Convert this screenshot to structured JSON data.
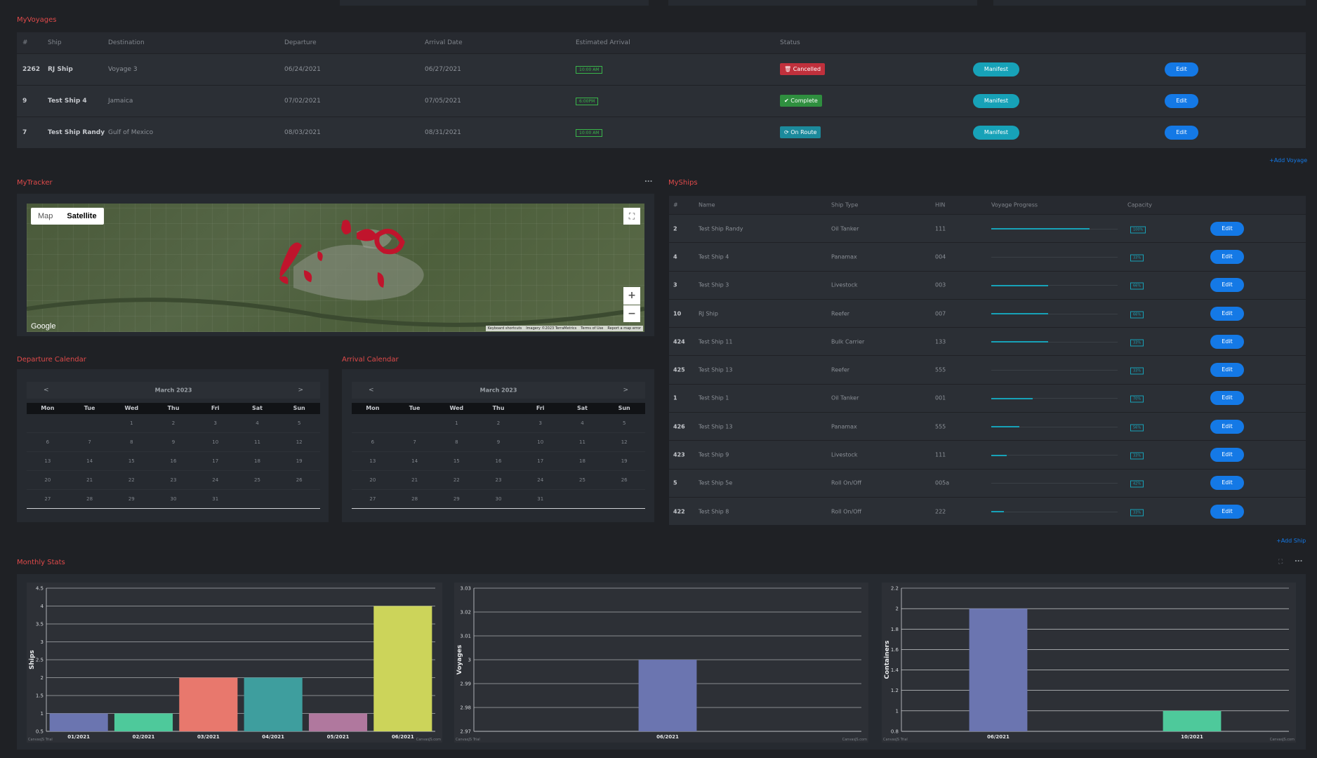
{
  "voyages": {
    "title": "MyVoyages",
    "headers": [
      "#",
      "Ship",
      "Destination",
      "Departure",
      "Arrival Date",
      "Estimated Arrival",
      "Status"
    ],
    "rows": [
      {
        "id": "2262",
        "ship": "RJ Ship",
        "destination": "Voyage 3",
        "departure": "06/24/2021",
        "arrival": "06/27/2021",
        "eta": "10:00 AM",
        "status": "Cancelled",
        "manifest": "Manifest",
        "edit": "Edit"
      },
      {
        "id": "9",
        "ship": "Test Ship 4",
        "destination": "Jamaica",
        "departure": "07/02/2021",
        "arrival": "07/05/2021",
        "eta": "6:00PM",
        "status": "Complete",
        "manifest": "Manifest",
        "edit": "Edit"
      },
      {
        "id": "7",
        "ship": "Test Ship Randy",
        "destination": "Gulf of Mexico",
        "departure": "08/03/2021",
        "arrival": "08/31/2021",
        "eta": "10:00 AM",
        "status": "On Route",
        "manifest": "Manifest",
        "edit": "Edit"
      }
    ],
    "add_link": "+Add Voyage"
  },
  "tracker": {
    "title": "MyTracker",
    "menu": "...",
    "map_label": "Map",
    "satellite_label": "Satellite",
    "google": "Google",
    "footer": [
      "Keyboard shortcuts",
      "Imagery ©2023 TerraMetrics",
      "Terms of Use",
      "Report a map error"
    ]
  },
  "departure_calendar": {
    "title": "Departure Calendar",
    "month": "March 2023",
    "prev": "<",
    "next": ">",
    "weekdays": [
      "Mon",
      "Tue",
      "Wed",
      "Thu",
      "Fri",
      "Sat",
      "Sun"
    ],
    "weeks": [
      [
        "",
        "",
        "1",
        "2",
        "3",
        "4",
        "5"
      ],
      [
        "6",
        "7",
        "8",
        "9",
        "10",
        "11",
        "12"
      ],
      [
        "13",
        "14",
        "15",
        "16",
        "17",
        "18",
        "19"
      ],
      [
        "20",
        "21",
        "22",
        "23",
        "24",
        "25",
        "26"
      ],
      [
        "27",
        "28",
        "29",
        "30",
        "31",
        "",
        ""
      ]
    ]
  },
  "arrival_calendar": {
    "title": "Arrival Calendar",
    "month": "March 2023",
    "prev": "<",
    "next": ">",
    "weekdays": [
      "Mon",
      "Tue",
      "Wed",
      "Thu",
      "Fri",
      "Sat",
      "Sun"
    ],
    "weeks": [
      [
        "",
        "",
        "1",
        "2",
        "3",
        "4",
        "5"
      ],
      [
        "6",
        "7",
        "8",
        "9",
        "10",
        "11",
        "12"
      ],
      [
        "13",
        "14",
        "15",
        "16",
        "17",
        "18",
        "19"
      ],
      [
        "20",
        "21",
        "22",
        "23",
        "24",
        "25",
        "26"
      ],
      [
        "27",
        "28",
        "29",
        "30",
        "31",
        "",
        ""
      ]
    ]
  },
  "ships": {
    "title": "MyShips",
    "headers": [
      "#",
      "Name",
      "Ship Type",
      "HIN",
      "Voyage Progress",
      "Capacity"
    ],
    "rows": [
      {
        "id": "2",
        "name": "Test Ship Randy",
        "type": "Oil Tanker",
        "hin": "111",
        "progress": 0.78,
        "capacity": "100%",
        "edit": "Edit"
      },
      {
        "id": "4",
        "name": "Test Ship 4",
        "type": "Panamax",
        "hin": "004",
        "progress": 0,
        "capacity": "33%",
        "edit": "Edit"
      },
      {
        "id": "3",
        "name": "Test Ship 3",
        "type": "Livestock",
        "hin": "003",
        "progress": 0.45,
        "capacity": "66%",
        "edit": "Edit"
      },
      {
        "id": "10",
        "name": "RJ Ship",
        "type": "Reefer",
        "hin": "007",
        "progress": 0.45,
        "capacity": "66%",
        "edit": "Edit"
      },
      {
        "id": "424",
        "name": "Test Ship 11",
        "type": "Bulk Carrier",
        "hin": "133",
        "progress": 0.45,
        "capacity": "33%",
        "edit": "Edit"
      },
      {
        "id": "425",
        "name": "Test Ship 13",
        "type": "Reefer",
        "hin": "555",
        "progress": 0,
        "capacity": "33%",
        "edit": "Edit"
      },
      {
        "id": "1",
        "name": "Test Ship 1",
        "type": "Oil Tanker",
        "hin": "001",
        "progress": 0.33,
        "capacity": "70%",
        "edit": "Edit"
      },
      {
        "id": "426",
        "name": "Test Ship 13",
        "type": "Panamax",
        "hin": "555",
        "progress": 0.22,
        "capacity": "56%",
        "edit": "Edit"
      },
      {
        "id": "423",
        "name": "Test Ship 9",
        "type": "Livestock",
        "hin": "111",
        "progress": 0.12,
        "capacity": "33%",
        "edit": "Edit"
      },
      {
        "id": "5",
        "name": "Test Ship 5e",
        "type": "Roll On/Off",
        "hin": "005a",
        "progress": 0,
        "capacity": "42%",
        "edit": "Edit"
      },
      {
        "id": "422",
        "name": "Test Ship 8",
        "type": "Roll On/Off",
        "hin": "222",
        "progress": 0.1,
        "capacity": "33%",
        "edit": "Edit"
      }
    ],
    "add_link": "+Add Ship"
  },
  "monthly_stats": {
    "title": "Monthly Stats",
    "menu": "..."
  },
  "chart_data": [
    {
      "type": "bar",
      "ylabel": "Ships",
      "categories": [
        "01/2021",
        "02/2021",
        "03/2021",
        "04/2021",
        "05/2021",
        "06/2021"
      ],
      "values": [
        1,
        1,
        2,
        2,
        1,
        4
      ],
      "colors": [
        "#6b75b0",
        "#4ec99b",
        "#e8786d",
        "#3e9e9e",
        "#b0789e",
        "#ccd45a"
      ],
      "ylim": [
        0.5,
        4.5
      ],
      "yticks": [
        "0.5",
        "1",
        "1.5",
        "2",
        "2.5",
        "3",
        "3.5",
        "4",
        "4.5"
      ],
      "credit_left": "CanvasJS Trial",
      "credit_right": "CanvasJS.com"
    },
    {
      "type": "bar",
      "ylabel": "Voyages",
      "categories": [
        "06/2021"
      ],
      "values": [
        3
      ],
      "colors": [
        "#6b75b0"
      ],
      "ylim": [
        2.97,
        3.03
      ],
      "yticks": [
        "2.97",
        "2.98",
        "2.99",
        "3",
        "3.01",
        "3.02",
        "3.03"
      ],
      "credit_left": "CanvasJS Trial",
      "credit_right": "CanvasJS.com"
    },
    {
      "type": "bar",
      "ylabel": "Containers",
      "categories": [
        "06/2021",
        "10/2021"
      ],
      "values": [
        2,
        1
      ],
      "colors": [
        "#6b75b0",
        "#4ec99b"
      ],
      "ylim": [
        0.8,
        2.2
      ],
      "yticks": [
        "0.8",
        "1",
        "1.2",
        "1.4",
        "1.6",
        "1.8",
        "2",
        "2.2"
      ],
      "credit_left": "CanvasJS Trial",
      "credit_right": "CanvasJS.com"
    }
  ]
}
